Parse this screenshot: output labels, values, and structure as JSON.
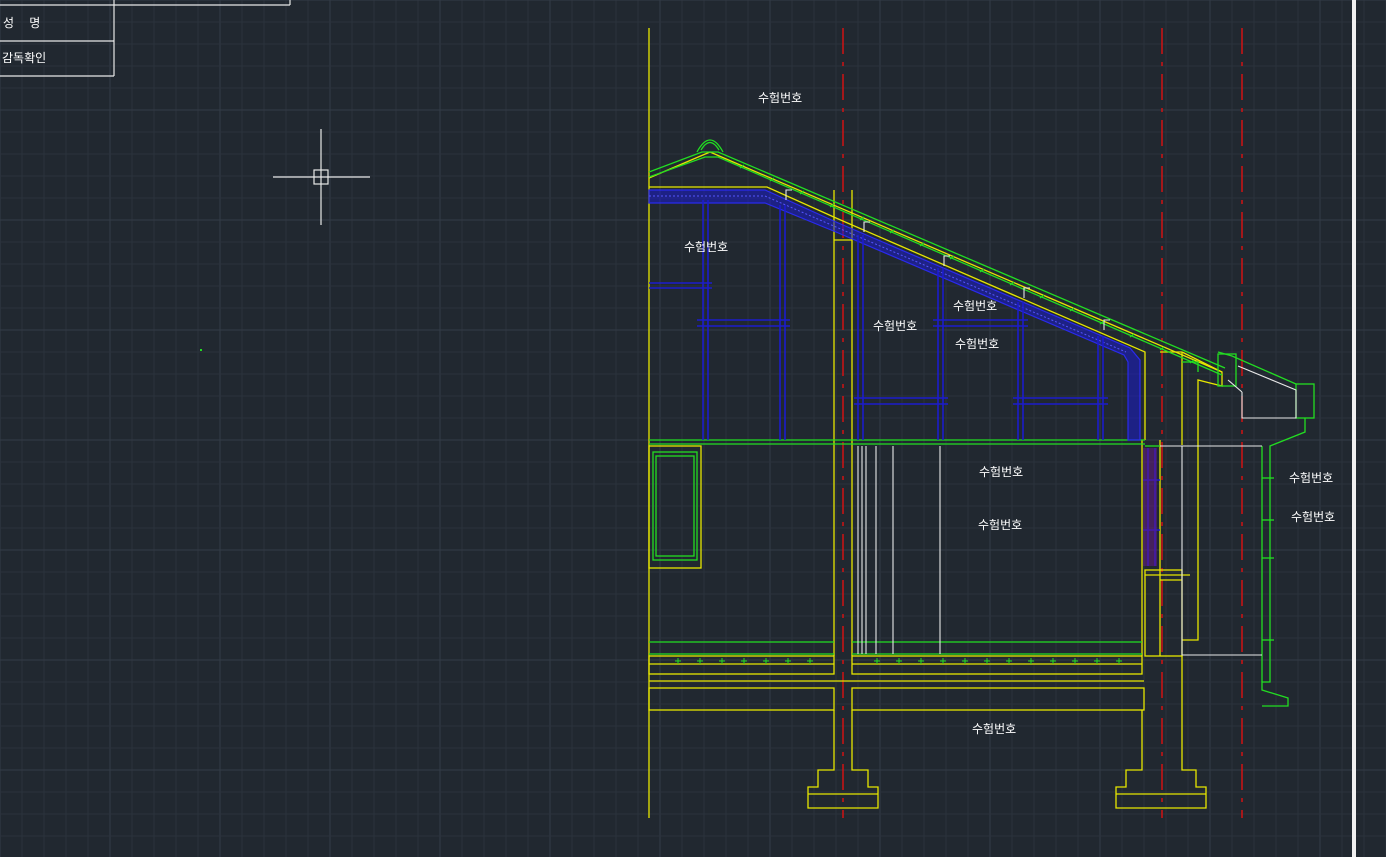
{
  "title_block": {
    "name_label": "성    명",
    "supervisor_label": "감독확인"
  },
  "labels": {
    "top_ridge": "수험번호",
    "attic_left": "수험번호",
    "attic_mid": "수험번호",
    "attic_right_1": "수험번호",
    "attic_right_2": "수험번호",
    "room_1": "수험번호",
    "room_2": "수험번호",
    "eave_1": "수험번호",
    "eave_2": "수험번호",
    "foundation": "수험번호"
  },
  "colors": {
    "background": "#212830",
    "grid_minor": "#2b323c",
    "grid_major": "#343c47",
    "yellow": "#e6e600",
    "green": "#22dd22",
    "blue": "#1c1ccc",
    "red": "#dd1111",
    "white": "#e8e8e8"
  }
}
